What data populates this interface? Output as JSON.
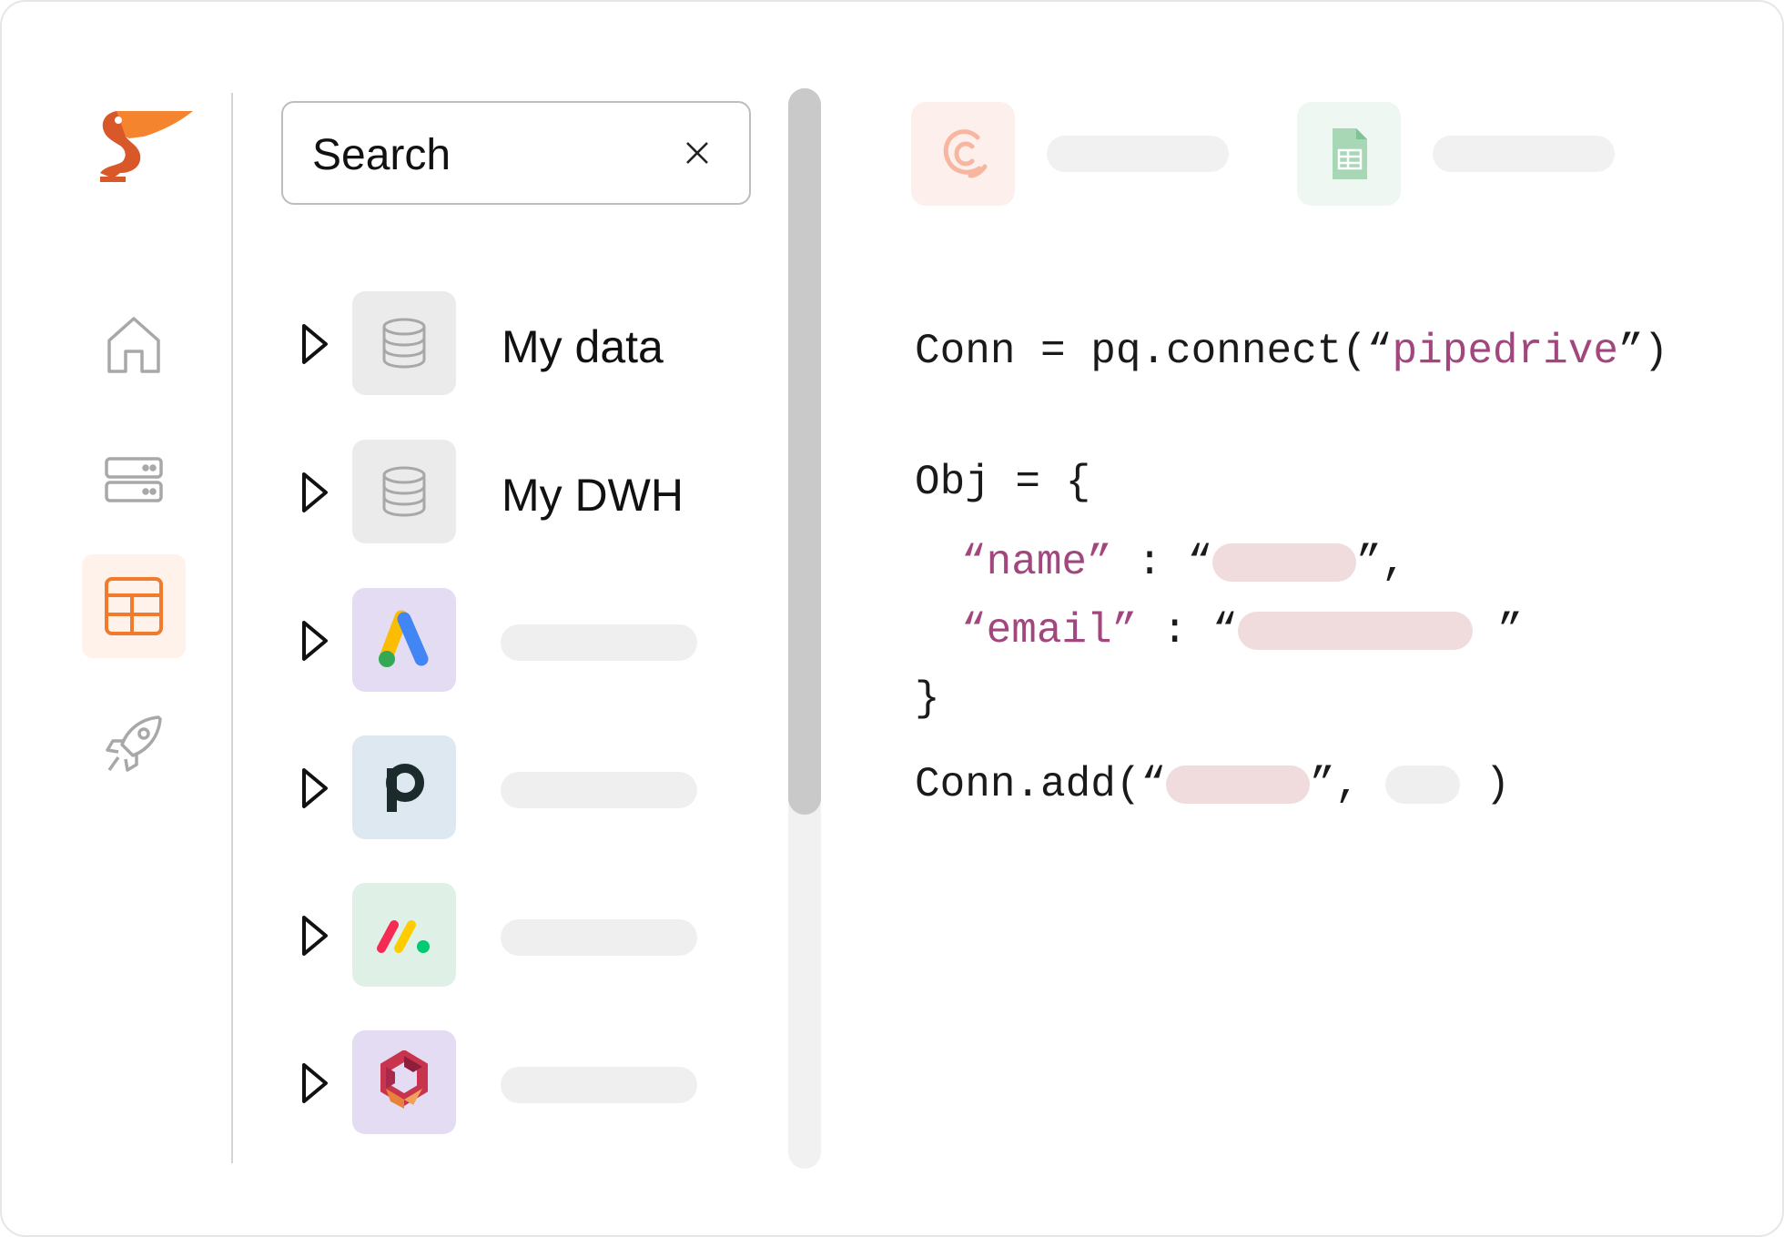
{
  "search": {
    "placeholder": "Search"
  },
  "tree": {
    "items": [
      {
        "label": "My data",
        "icon": "database-icon",
        "icon_bg": "#ebebeb"
      },
      {
        "label": "My DWH",
        "icon": "database-icon",
        "icon_bg": "#ebebeb"
      },
      {
        "label": "",
        "icon": "google-ads-icon",
        "icon_bg": "#e3dcf3"
      },
      {
        "label": "",
        "icon": "pipedrive-icon",
        "icon_bg": "#dde8f1"
      },
      {
        "label": "",
        "icon": "monday-icon",
        "icon_bg": "#dff1e6"
      },
      {
        "label": "",
        "icon": "hexagon-logo-icon",
        "icon_bg": "#e3dcf3"
      }
    ]
  },
  "nav": {
    "active": "tables"
  },
  "code": {
    "line1": {
      "prefix": "Conn = pq.connect(“",
      "string": "pipedrive",
      "suffix": "”)"
    },
    "line2": "Obj = {",
    "line3": {
      "key": "“name”",
      "sep": " : “"
    },
    "line4": {
      "key": "“email”",
      "sep": " : “"
    },
    "line5": "}",
    "line6": {
      "prefix": "Conn.add(“"
    }
  },
  "colors": {
    "accent": "#f07b2c",
    "string": "#a2467e",
    "pill": "#f0dcdc"
  }
}
